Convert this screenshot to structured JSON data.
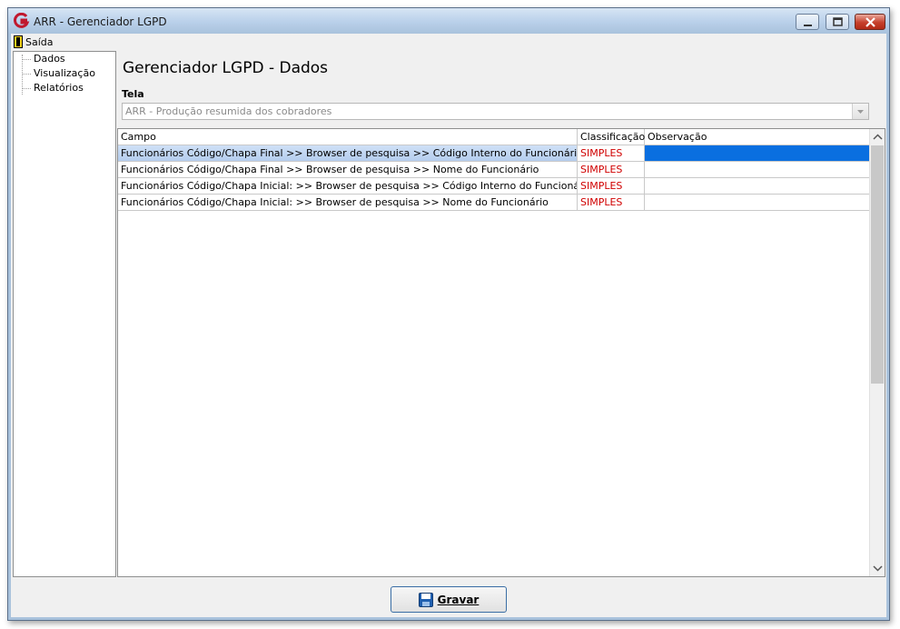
{
  "window": {
    "title": "ARR - Gerenciador LGPD"
  },
  "menu": {
    "exit_label": "Saída"
  },
  "tree": {
    "items": [
      "Dados",
      "Visualização",
      "Relatórios"
    ]
  },
  "main": {
    "title": "Gerenciador LGPD - Dados",
    "tela_label": "Tela",
    "tela_value": "ARR - Produção resumida dos cobradores"
  },
  "grid": {
    "columns": [
      "Campo",
      "Classificação",
      "Observação"
    ],
    "rows": [
      {
        "campo": "Funcionários Código/Chapa Final >> Browser de pesquisa >> Código Interno do Funcionário",
        "classificacao": "SIMPLES",
        "observacao": ""
      },
      {
        "campo": "Funcionários Código/Chapa Final >> Browser de pesquisa >> Nome do Funcionário",
        "classificacao": "SIMPLES",
        "observacao": ""
      },
      {
        "campo": "Funcionários Código/Chapa Inicial: >> Browser de pesquisa >> Código Interno do Funcionário",
        "classificacao": "SIMPLES",
        "observacao": ""
      },
      {
        "campo": "Funcionários Código/Chapa Inicial: >> Browser de pesquisa >> Nome do Funcionário",
        "classificacao": "SIMPLES",
        "observacao": ""
      }
    ],
    "selected_row": 0
  },
  "footer": {
    "save_label": "Gravar"
  },
  "colors": {
    "accent": "#0a6fe0",
    "classification": "#d00000",
    "title_bar": "#b9d0ea"
  }
}
